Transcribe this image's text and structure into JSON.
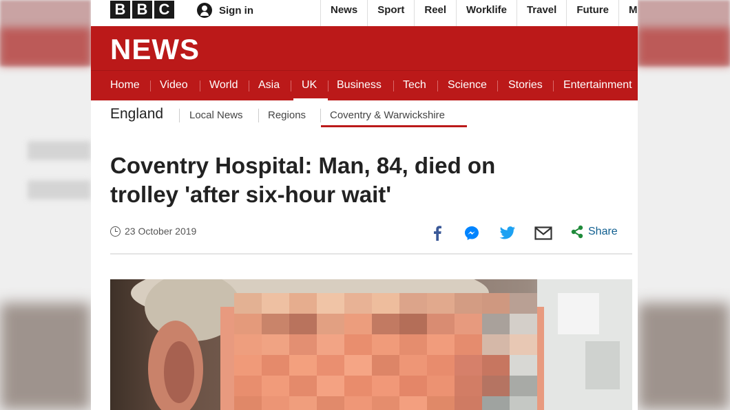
{
  "topbar": {
    "logo_letters": [
      "B",
      "B",
      "C"
    ],
    "signin_label": "Sign in",
    "nav": [
      "News",
      "Sport",
      "Reel",
      "Worklife",
      "Travel",
      "Future",
      "M"
    ]
  },
  "news_header": {
    "title": "NEWS",
    "nav": [
      "Home",
      "Video",
      "World",
      "Asia",
      "UK",
      "Business",
      "Tech",
      "Science",
      "Stories",
      "Entertainment"
    ],
    "active": "UK"
  },
  "subnav": {
    "home": "England",
    "items": [
      "Local News",
      "Regions",
      "Coventry & Warwickshire"
    ],
    "active": "Coventry & Warwickshire"
  },
  "article": {
    "headline_line1": "Coventry Hospital: Man, 84, died on",
    "headline_line2": "trolley 'after six-hour wait'",
    "date": "23 October 2019",
    "share_label": "Share",
    "share_icons": [
      "facebook-icon",
      "messenger-icon",
      "twitter-icon",
      "email-icon",
      "share-icon"
    ]
  },
  "colors": {
    "bbc_red": "#bb1919",
    "share_blue": "#0f5e8f"
  }
}
